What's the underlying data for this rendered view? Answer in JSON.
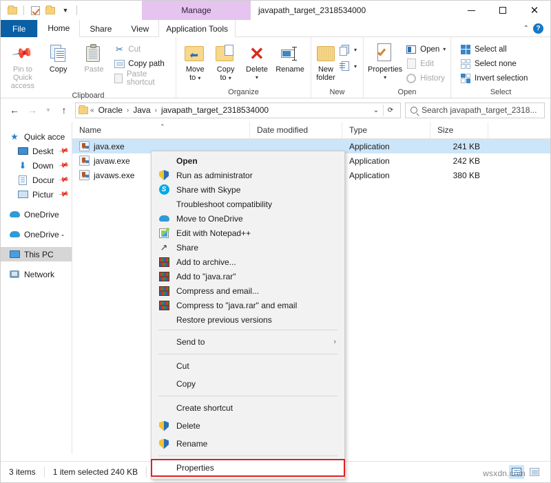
{
  "window": {
    "title": "javapath_target_2318534000",
    "manage_tab_label": "Manage",
    "minimize_label": "Minimize",
    "maximize_label": "Maximize",
    "close_label": "Close"
  },
  "quick_access_toolbar": {
    "items": [
      {
        "name": "explorer-icon",
        "icon": "folder-icon"
      },
      {
        "name": "properties-qat",
        "icon": "checkbox-icon"
      },
      {
        "name": "new-folder-qat",
        "icon": "folder-icon"
      },
      {
        "name": "customize-qat",
        "icon": "chevron-down-icon"
      }
    ]
  },
  "ribbon": {
    "tabs": [
      {
        "label": "File",
        "id": "file",
        "state": "file"
      },
      {
        "label": "Home",
        "id": "home",
        "state": "active"
      },
      {
        "label": "Share",
        "id": "share",
        "state": "normal"
      },
      {
        "label": "View",
        "id": "view",
        "state": "normal"
      },
      {
        "label": "Application Tools",
        "id": "application-tools",
        "state": "contextual"
      }
    ],
    "collapse_label": "Minimize the Ribbon",
    "help_label": "?",
    "groups": [
      {
        "id": "clipboard",
        "label": "Clipboard",
        "big_buttons": [
          {
            "label": "Pin to Quick\naccess",
            "line1": "Pin to Quick",
            "line2": "access",
            "icon": "pin-icon",
            "enabled": false
          },
          {
            "label": "Copy",
            "line1": "Copy",
            "line2": "",
            "icon": "copy-icon",
            "enabled": true
          },
          {
            "label": "Paste",
            "line1": "Paste",
            "line2": "",
            "icon": "paste-icon",
            "enabled": false
          }
        ],
        "small_buttons": [
          {
            "label": "Cut",
            "icon": "scissors-icon",
            "enabled": false
          },
          {
            "label": "Copy path",
            "icon": "copy-path-icon",
            "enabled": true
          },
          {
            "label": "Paste shortcut",
            "icon": "paste-shortcut-icon",
            "enabled": false
          }
        ]
      },
      {
        "id": "organize",
        "label": "Organize",
        "big_buttons": [
          {
            "line1": "Move",
            "line2": "to",
            "icon": "move-to-icon",
            "has_caret": true
          },
          {
            "line1": "Copy",
            "line2": "to",
            "icon": "copy-to-icon",
            "has_caret": true
          },
          {
            "line1": "Delete",
            "line2": "",
            "icon": "delete-icon",
            "has_caret": true
          },
          {
            "line1": "Rename",
            "line2": "",
            "icon": "rename-icon",
            "has_caret": false
          }
        ]
      },
      {
        "id": "new",
        "label": "New",
        "big_buttons": [
          {
            "line1": "New",
            "line2": "folder",
            "icon": "new-folder-icon",
            "has_caret": false
          }
        ],
        "small_buttons": [
          {
            "label": "",
            "icon": "new-item-icon",
            "has_caret": true
          },
          {
            "label": "",
            "icon": "easy-access-icon",
            "has_caret": true
          }
        ]
      },
      {
        "id": "open",
        "label": "Open",
        "big_buttons": [
          {
            "line1": "Properties",
            "line2": "",
            "icon": "properties-icon",
            "has_caret": true
          }
        ],
        "small_buttons": [
          {
            "label": "Open",
            "icon": "open-icon",
            "enabled": true,
            "has_caret": true
          },
          {
            "label": "Edit",
            "icon": "edit-icon",
            "enabled": false
          },
          {
            "label": "History",
            "icon": "history-icon",
            "enabled": false
          }
        ]
      },
      {
        "id": "select",
        "label": "Select",
        "small_buttons": [
          {
            "label": "Select all",
            "icon": "select-all-icon",
            "enabled": true
          },
          {
            "label": "Select none",
            "icon": "select-none-icon",
            "enabled": true
          },
          {
            "label": "Invert selection",
            "icon": "invert-selection-icon",
            "enabled": true
          }
        ]
      }
    ]
  },
  "address_bar": {
    "back_label": "Back",
    "forward_label": "Forward",
    "recent_label": "Recent locations",
    "up_label": "Up",
    "breadcrumbs": [
      {
        "label": "«",
        "type": "overflow"
      },
      {
        "label": "Oracle",
        "type": "crumb"
      },
      {
        "label": "Java",
        "type": "crumb"
      },
      {
        "label": "javapath_target_2318534000",
        "type": "crumb"
      }
    ],
    "dropdown_label": "Previous locations",
    "refresh_label": "Refresh",
    "search_placeholder": "Search javapath_target_2318...",
    "search_value": "Search javapath_target_2318..."
  },
  "nav_pane": {
    "items": [
      {
        "label": "Quick acce",
        "icon": "star-icon",
        "indent": false,
        "pinned": false,
        "selected": false
      },
      {
        "label": "Deskt",
        "icon": "desktop-icon",
        "indent": true,
        "pinned": true,
        "selected": false
      },
      {
        "label": "Down",
        "icon": "downloads-icon",
        "indent": true,
        "pinned": true,
        "selected": false
      },
      {
        "label": "Docur",
        "icon": "documents-icon",
        "indent": true,
        "pinned": true,
        "selected": false
      },
      {
        "label": "Pictur",
        "icon": "pictures-icon",
        "indent": true,
        "pinned": true,
        "selected": false
      },
      {
        "label": "OneDrive",
        "icon": "onedrive-icon",
        "indent": false,
        "pinned": false,
        "selected": false
      },
      {
        "label": "OneDrive -",
        "icon": "onedrive-icon",
        "indent": false,
        "pinned": false,
        "selected": false
      },
      {
        "label": "This PC",
        "icon": "this-pc-icon",
        "indent": false,
        "pinned": false,
        "selected": true
      },
      {
        "label": "Network",
        "icon": "network-icon",
        "indent": false,
        "pinned": false,
        "selected": false
      }
    ]
  },
  "file_list": {
    "columns": [
      {
        "label": "Name",
        "key": "name",
        "sorted": true
      },
      {
        "label": "Date modified",
        "key": "date"
      },
      {
        "label": "Type",
        "key": "type"
      },
      {
        "label": "Size",
        "key": "size"
      }
    ],
    "rows": [
      {
        "name": "java.exe",
        "date": "",
        "type": "Application",
        "size": "241 KB",
        "selected": true,
        "icon": "java-exe-icon"
      },
      {
        "name": "javaw.exe",
        "date": "",
        "type": "Application",
        "size": "242 KB",
        "selected": false,
        "icon": "java-exe-icon"
      },
      {
        "name": "javaws.exe",
        "date": "",
        "type": "Application",
        "size": "380 KB",
        "selected": false,
        "icon": "java-exe-icon"
      }
    ]
  },
  "context_menu": {
    "items": [
      {
        "label": "Open",
        "icon": null,
        "bold": true,
        "type": "item"
      },
      {
        "label": "Run as administrator",
        "icon": "shield-icon",
        "type": "item"
      },
      {
        "label": "Share with Skype",
        "icon": "skype-icon",
        "type": "item"
      },
      {
        "label": "Troubleshoot compatibility",
        "icon": null,
        "type": "item"
      },
      {
        "label": "Move to OneDrive",
        "icon": "onedrive-icon",
        "type": "item"
      },
      {
        "label": "Edit with Notepad++",
        "icon": "notepadpp-icon",
        "type": "item"
      },
      {
        "label": "Share",
        "icon": "share-icon",
        "type": "item"
      },
      {
        "label": "Add to archive...",
        "icon": "winrar-icon",
        "type": "item"
      },
      {
        "label": "Add to \"java.rar\"",
        "icon": "winrar-icon",
        "type": "item"
      },
      {
        "label": "Compress and email...",
        "icon": "winrar-icon",
        "type": "item"
      },
      {
        "label": "Compress to \"java.rar\" and email",
        "icon": "winrar-icon",
        "type": "item"
      },
      {
        "label": "Restore previous versions",
        "icon": null,
        "type": "item"
      },
      {
        "type": "separator"
      },
      {
        "label": "Send to",
        "icon": null,
        "type": "submenu",
        "arrow": "›"
      },
      {
        "type": "separator"
      },
      {
        "label": "Cut",
        "icon": null,
        "type": "item"
      },
      {
        "label": "Copy",
        "icon": null,
        "type": "item"
      },
      {
        "type": "separator"
      },
      {
        "label": "Create shortcut",
        "icon": null,
        "type": "item"
      },
      {
        "label": "Delete",
        "icon": "shield-icon",
        "type": "item"
      },
      {
        "label": "Rename",
        "icon": "shield-icon",
        "type": "item"
      },
      {
        "type": "separator"
      },
      {
        "label": "Properties",
        "icon": null,
        "type": "item",
        "highlighted": true
      }
    ],
    "highlight_color": "#e02020"
  },
  "status_bar": {
    "item_count": "3 items",
    "selection": "1 item selected  240 KB",
    "view_details_label": "Details view",
    "view_large_label": "Large icons view"
  },
  "watermark": {
    "text": "wsxdn.com"
  }
}
